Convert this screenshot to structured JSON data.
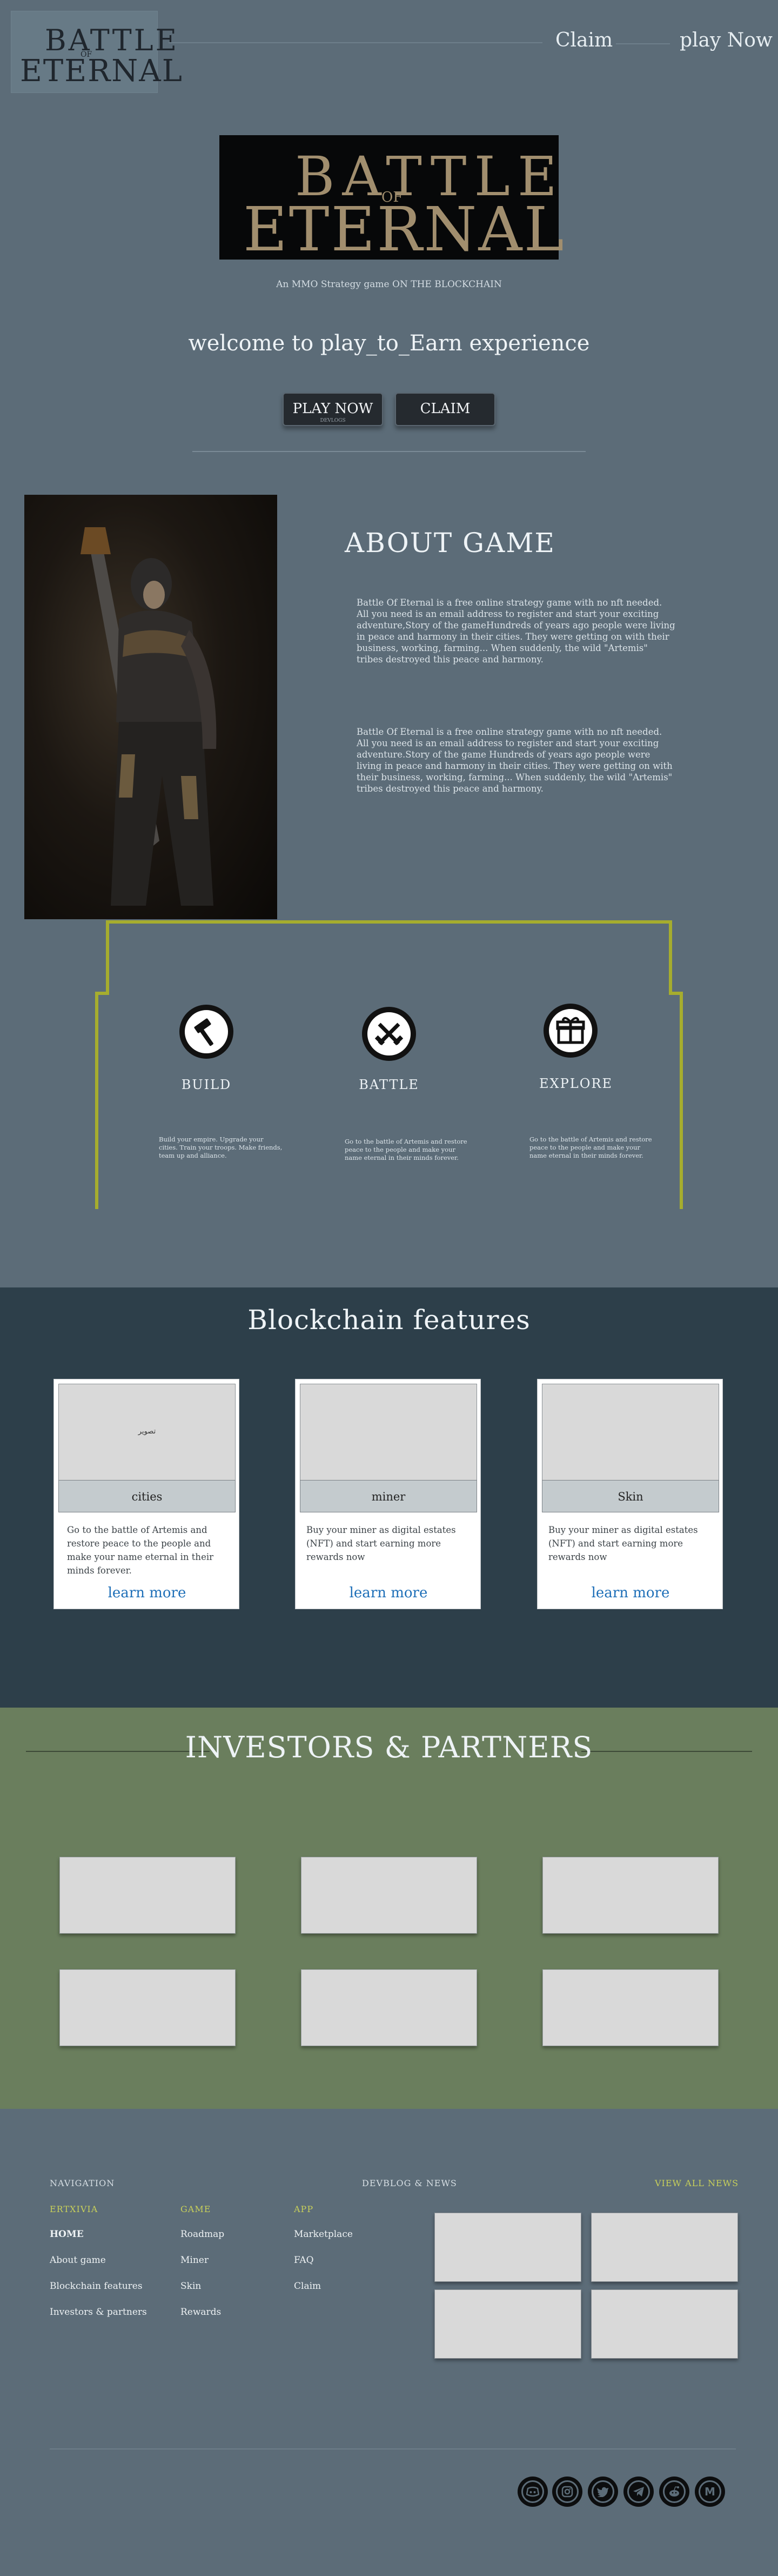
{
  "header": {
    "logo": {
      "line1": "BATTLE",
      "line2": "OF",
      "line3": "ETERNAL"
    },
    "nav": [
      {
        "label": "Claim"
      },
      {
        "label": "play Now"
      }
    ]
  },
  "hero": {
    "logo": {
      "line1": "BATTLE",
      "line2": "OF",
      "line3": "ETERNAL"
    },
    "tagline": "An MMO Strategy game ON THE BLOCKCHAIN",
    "welcome": "welcome to play_to_Earn experience",
    "play_button": "PLAY NOW",
    "play_sub": "DEVLOGS",
    "claim_button": "CLAIM"
  },
  "about": {
    "title": "ABOUT GAME",
    "paragraph1": "Battle Of Eternal is a free online strategy game with no nft needed. All you need is an email address to register and start your exciting adventure,Story of the gameHundreds of years ago people were living in peace and harmony in their cities. They were getting on with their business, working, farming... When suddenly, the wild \"Artemis\" tribes destroyed this peace and harmony.",
    "paragraph2": "Battle Of Eternal is a free online strategy game with no nft needed. All you need is an email address to register and start your exciting adventure.Story of the game Hundreds of years ago people were living in peace and harmony in their cities. They were getting on with their business, working, farming... When suddenly, the wild \"Artemis\" tribes destroyed this peace and harmony."
  },
  "features": [
    {
      "icon": "hammer-icon",
      "title": "BUILD",
      "text": "Build your empire. Upgrade your cities. Train your troops. Make friends, team up and alliance."
    },
    {
      "icon": "crossed-swords-icon",
      "title": "BATTLE",
      "text": "Go to the battle of Artemis and restore peace to the people and make your name eternal in their minds forever."
    },
    {
      "icon": "treasure-chest-icon",
      "title": "EXPLORE",
      "text": "Go to the battle of Artemis and restore peace to the people and make your name eternal in their minds forever."
    }
  ],
  "blockchain": {
    "title": "Blockchain features",
    "cards": [
      {
        "image_alt": "تصویر",
        "label": "cities",
        "text": "Go to the battle of Artemis and restore peace to the people and make your name eternal in their minds forever.",
        "link": "learn more"
      },
      {
        "image_alt": "",
        "label": "miner",
        "text": "Buy your miner as digital estates (NFT) and start earning more rewards now",
        "link": "learn more"
      },
      {
        "image_alt": "",
        "label": "Skin",
        "text": "Buy your miner as digital estates (NFT) and start earning more rewards now",
        "link": "learn more"
      }
    ]
  },
  "investors": {
    "title": "INVESTORS & PARTNERS"
  },
  "footer": {
    "nav_heading": "NAVIGATION",
    "devlog_heading": "DEVBLOG & NEWS",
    "view_all": "VIEW ALL NEWS",
    "columns": [
      {
        "heading": "ERTXIVIA",
        "links": [
          "HOME",
          "About game",
          "Blockchain features",
          "Investors & partners"
        ]
      },
      {
        "heading": "GAME",
        "links": [
          "Roadmap",
          "Miner",
          "Skin",
          "Rewards"
        ]
      },
      {
        "heading": "APP",
        "links": [
          "Marketplace",
          "FAQ",
          "Claim"
        ]
      }
    ],
    "social": [
      "discord-icon",
      "instagram-icon",
      "twitter-icon",
      "telegram-icon",
      "reddit-icon",
      "medium-icon"
    ]
  },
  "colors": {
    "page": "#5c6c78",
    "blockchain_bg": "#2d3f4a",
    "investors_bg": "#6a7e5d",
    "olive_accent": "#a6ad2e",
    "link_blue": "#1e6fb8"
  }
}
